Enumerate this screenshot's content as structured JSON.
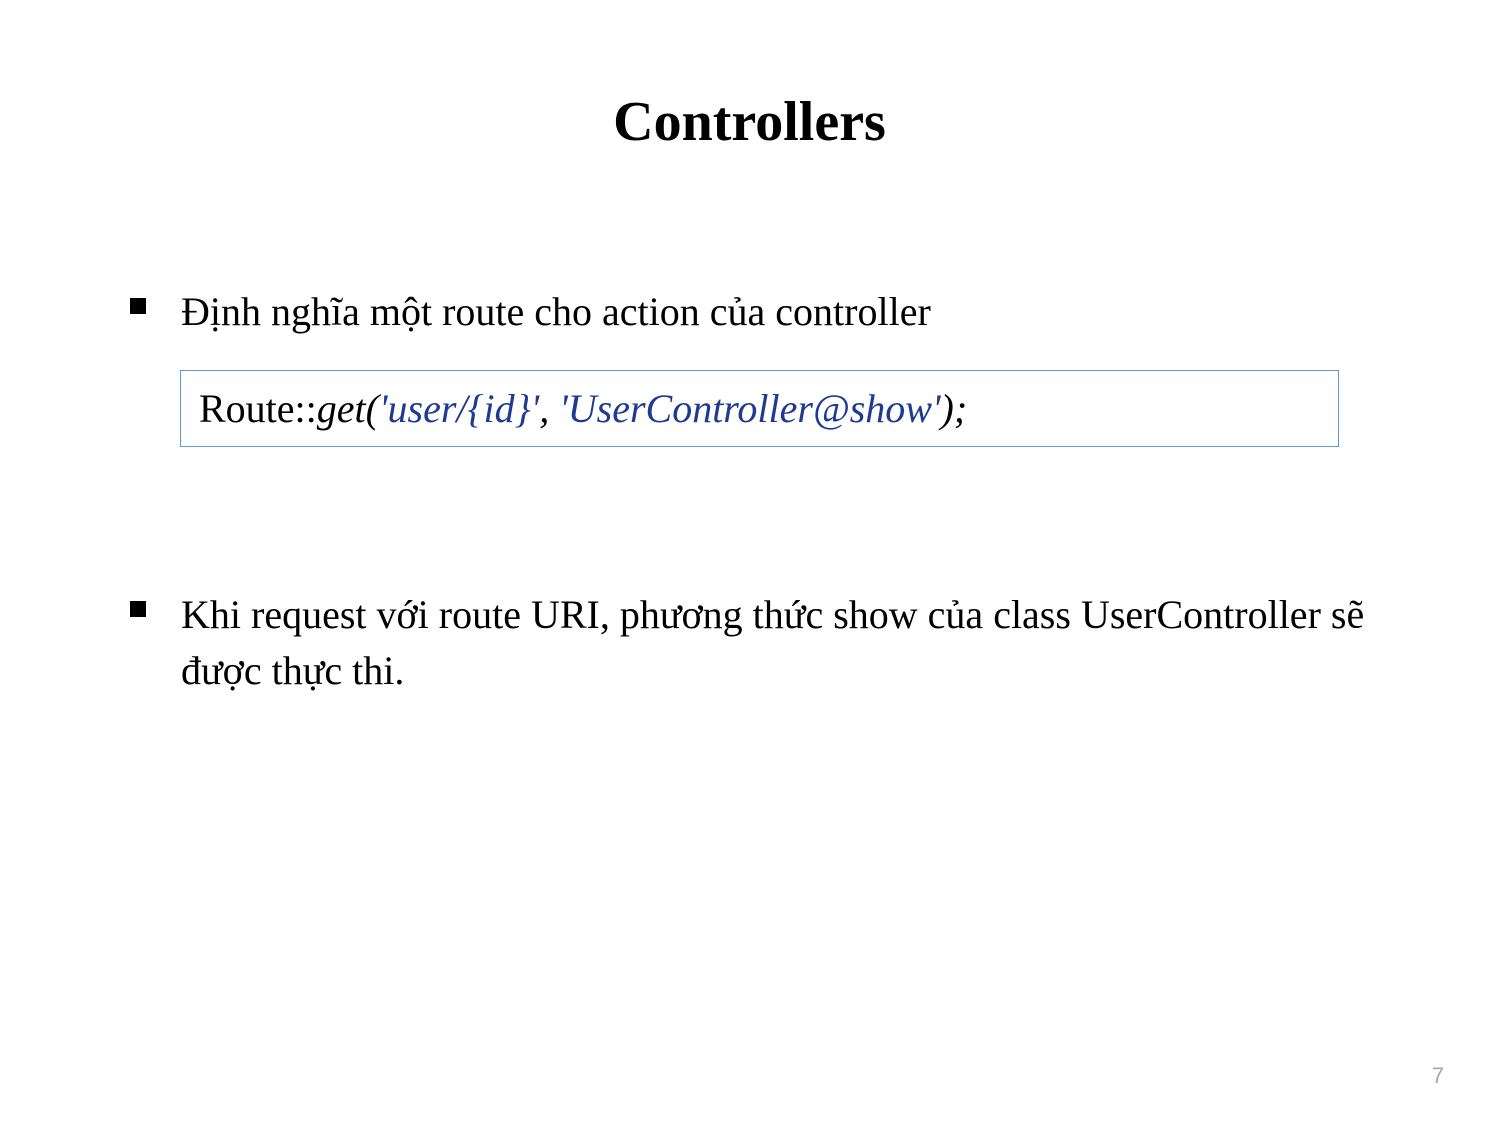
{
  "slide": {
    "title": "Controllers",
    "bullets": [
      {
        "text": "Định nghĩa một route cho action của controller"
      },
      {
        "text": "Khi request với route URI, phương thức show của class UserController sẽ được thực thi."
      }
    ],
    "code": {
      "prefix": "Route::",
      "method": "get(",
      "arg1": "'user/{id}'",
      "sep": ", ",
      "arg2": "'UserController@show'",
      "suffix": ");"
    },
    "page_number": "7"
  }
}
